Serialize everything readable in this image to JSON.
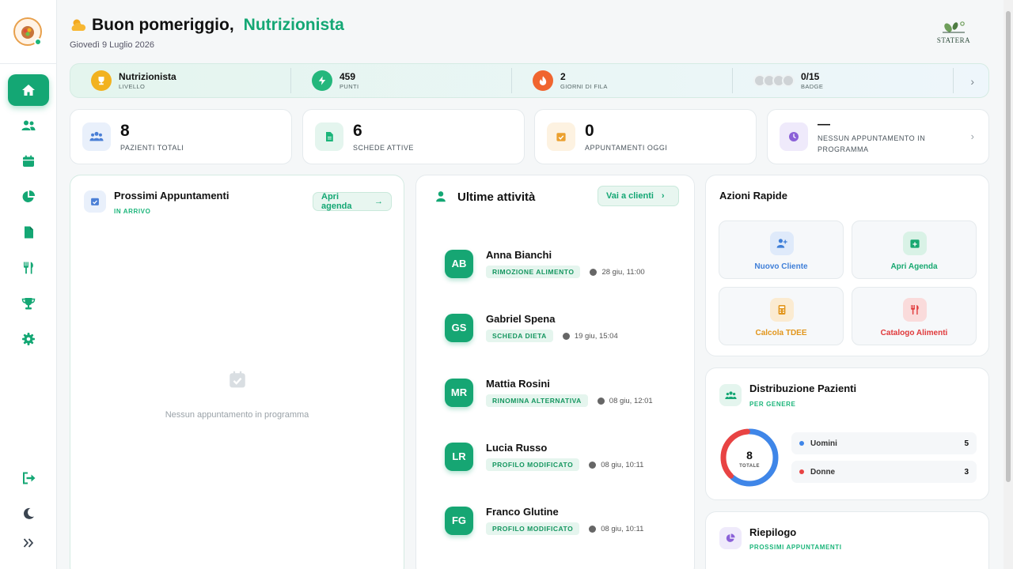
{
  "header": {
    "greeting": "Buon pomeriggio,",
    "name": "Nutrizionista",
    "date": "Giovedì 9 Luglio 2026",
    "brand": "STATERA"
  },
  "levelbar": [
    {
      "value": "Nutrizionista",
      "label": "LIVELLO",
      "color": "#f2b21f"
    },
    {
      "value": "459",
      "label": "PUNTI",
      "color": "#24b77c"
    },
    {
      "value": "2",
      "label": "GIORNI DI FILA",
      "color": "#f0652f"
    },
    {
      "value": "0/15",
      "label": "BADGE",
      "color": "#cfd3d6"
    }
  ],
  "stats": [
    {
      "value": "8",
      "label": "PAZIENTI TOTALI",
      "icon": "users-icon",
      "bg": "#e9f0fb",
      "fg": "#4a7fd6"
    },
    {
      "value": "6",
      "label": "SCHEDE ATTIVE",
      "icon": "document-icon",
      "bg": "#e4f5ee",
      "fg": "#1bb57a"
    },
    {
      "value": "0",
      "label": "APPUNTAMENTI OGGI",
      "icon": "calendar-check-icon",
      "bg": "#fdf2e1",
      "fg": "#eba02e"
    },
    {
      "value": "—",
      "label": "NESSUN APPUNTAMENTO IN PROGRAMMA",
      "icon": "clock-icon",
      "bg": "#efeafb",
      "fg": "#8b61d8"
    }
  ],
  "appointments": {
    "title": "Prossimi Appuntamenti",
    "subtitle": "IN ARRIVO",
    "button": "Apri agenda",
    "empty": "Nessun appuntamento in programma"
  },
  "activity": {
    "title": "Ultime attività",
    "button": "Vai a clienti",
    "items": [
      {
        "initials": "AB",
        "name": "Anna Bianchi",
        "tag": "RIMOZIONE ALIMENTO",
        "time": "28 giu, 11:00"
      },
      {
        "initials": "GS",
        "name": "Gabriel Spena",
        "tag": "SCHEDA DIETA",
        "time": "19 giu, 15:04"
      },
      {
        "initials": "MR",
        "name": "Mattia Rosini",
        "tag": "RINOMINA ALTERNATIVA",
        "time": "08 giu, 12:01"
      },
      {
        "initials": "LR",
        "name": "Lucia Russo",
        "tag": "PROFILO MODIFICATO",
        "time": "08 giu, 10:11"
      },
      {
        "initials": "FG",
        "name": "Franco Glutine",
        "tag": "PROFILO MODIFICATO",
        "time": "08 giu, 10:11"
      }
    ]
  },
  "quick": {
    "title": "Azioni Rapide",
    "items": [
      {
        "label": "Nuovo Cliente",
        "color": "#3f7fd8",
        "bg": "#dfeafa",
        "icon": "user-plus-icon"
      },
      {
        "label": "Apri Agenda",
        "color": "#17a870",
        "bg": "#d9f2e6",
        "icon": "calendar-plus-icon"
      },
      {
        "label": "Calcola TDEE",
        "color": "#e2961c",
        "bg": "#fbebd1",
        "icon": "calculator-icon"
      },
      {
        "label": "Catalogo Alimenti",
        "color": "#e0393b",
        "bg": "#fadbdb",
        "icon": "utensils-icon"
      }
    ]
  },
  "distribution": {
    "title": "Distribuzione Pazienti",
    "subtitle": "PER GENERE",
    "total": "8",
    "total_label": "TOTALE",
    "items": [
      {
        "label": "Uomini",
        "value": 5,
        "color": "#3f86e8"
      },
      {
        "label": "Donne",
        "value": 3,
        "color": "#e84343"
      }
    ]
  },
  "summary": {
    "title": "Riepilogo",
    "subtitle": "PROSSIMI APPUNTAMENTI"
  }
}
